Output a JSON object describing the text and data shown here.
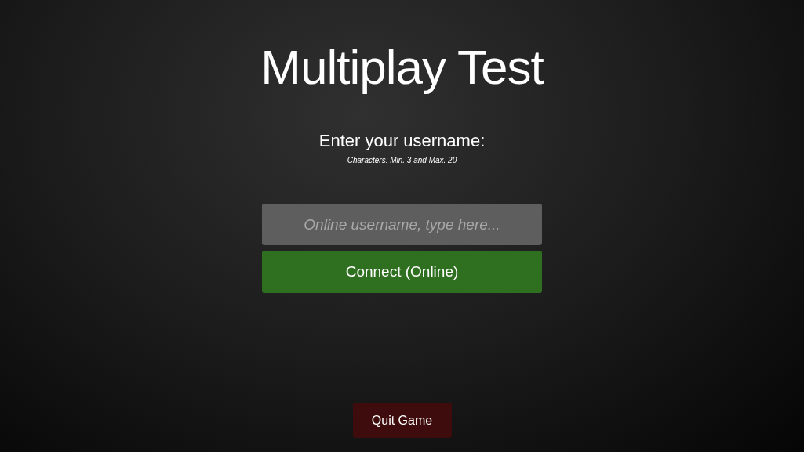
{
  "title": "Multiplay Test",
  "prompt": "Enter your username:",
  "hint": "Characters: Min. 3 and Max. 20",
  "username_field": {
    "placeholder": "Online username, type here..."
  },
  "connect_button": {
    "label": "Connect (Online)"
  },
  "quit_button": {
    "label": "Quit Game"
  }
}
